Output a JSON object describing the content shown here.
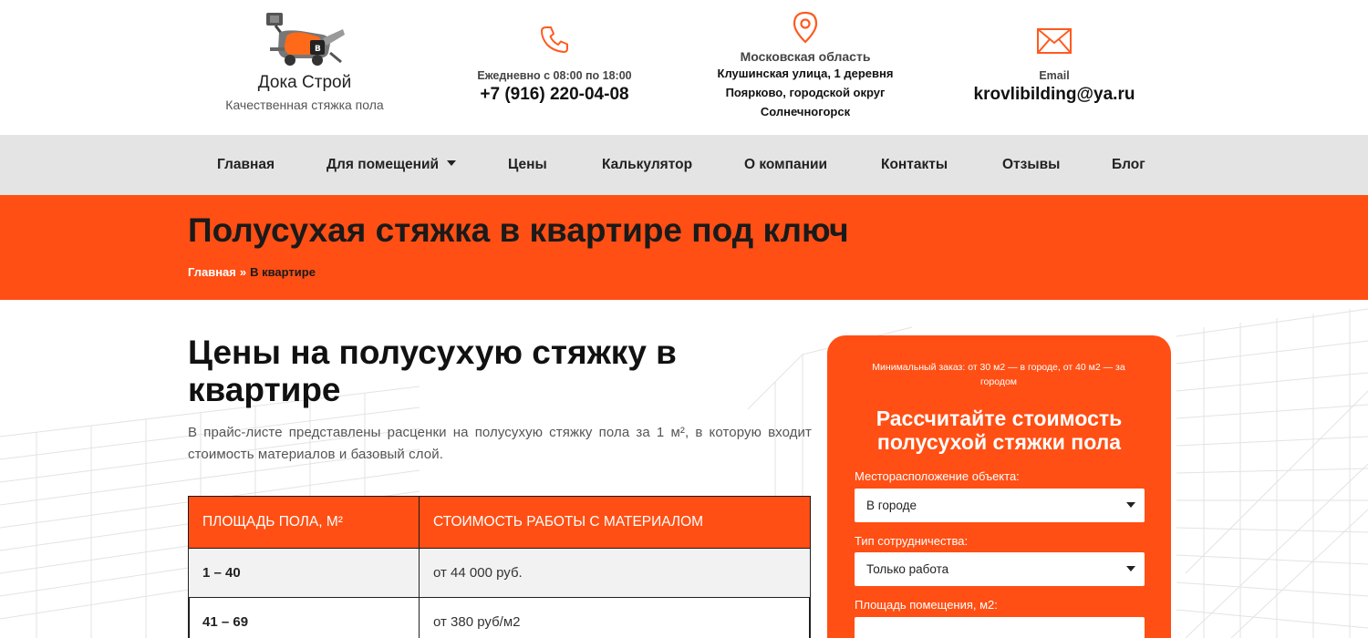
{
  "header": {
    "logo_name": "Дока Строй",
    "logo_tagline": "Качественная стяжка пола",
    "hours": "Ежедневно с 08:00 по 18:00",
    "phone": "+7 (916) 220-04-08",
    "region": "Московская область",
    "address_lines": [
      "Клушинская улица, 1 деревня",
      "Поярково, городской округ",
      "Солнечногорск"
    ],
    "email_label": "Email",
    "email": "krovlibilding@ya.ru",
    "accent_color": "#ff5a1f"
  },
  "nav": {
    "items": [
      {
        "label": "Главная"
      },
      {
        "label": "Для помещений",
        "has_dropdown": true
      },
      {
        "label": "Цены"
      },
      {
        "label": "Калькулятор"
      },
      {
        "label": "О компании"
      },
      {
        "label": "Контакты"
      },
      {
        "label": "Отзывы"
      },
      {
        "label": "Блог"
      }
    ]
  },
  "hero": {
    "title": "Полусухая стяжка в квартире под ключ",
    "breadcrumb_home": "Главная",
    "breadcrumb_sep": "»",
    "breadcrumb_current": "В квартире",
    "background": "#ff4f14"
  },
  "main": {
    "title": "Цены на полусухую стяжку в квартире",
    "intro": "В прайс-листе представлены расценки на полусухую стяжку пола за 1 м², в которую входит стоимость материалов и базовый слой.",
    "table": {
      "headers": [
        "ПЛОЩАДЬ ПОЛА, М²",
        "СТОИМОСТЬ РАБОТЫ С МАТЕРИАЛОМ"
      ],
      "rows": [
        [
          "1 – 40",
          "от 44 000 руб."
        ],
        [
          "41 – 69",
          "от 380 руб/м2"
        ]
      ]
    }
  },
  "calculator": {
    "note": "Минимальный заказ: от 30 м2 — в городе, от 40 м2 — за городом",
    "title": "Рассчитайте стоимость полусухой стяжки пола",
    "location_label": "Месторасположение объекта:",
    "location_value": "В городе",
    "cooperation_label": "Тип сотрудничества:",
    "cooperation_value": "Только работа",
    "area_label": "Площадь помещения, м2:",
    "area_value": ""
  }
}
